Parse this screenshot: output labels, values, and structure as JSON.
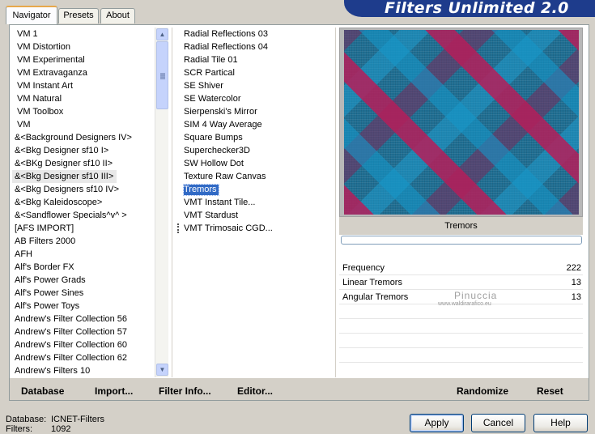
{
  "tabs": [
    {
      "label": "Navigator",
      "active": true
    },
    {
      "label": "Presets",
      "active": false
    },
    {
      "label": "About",
      "active": false
    }
  ],
  "banner": {
    "title": "Filters Unlimited 2.0"
  },
  "categories": {
    "items": [
      {
        "label": "VM 1"
      },
      {
        "label": "VM Distortion"
      },
      {
        "label": "VM Experimental"
      },
      {
        "label": "VM Extravaganza"
      },
      {
        "label": "VM Instant Art"
      },
      {
        "label": "VM Natural"
      },
      {
        "label": "VM Toolbox"
      },
      {
        "label": "VM"
      },
      {
        "label": "&<Background Designers IV>"
      },
      {
        "label": "&<Bkg Designer sf10 I>"
      },
      {
        "label": "&<BKg Designer sf10 II>"
      },
      {
        "label": "&<Bkg Designer sf10 III>",
        "selected": true
      },
      {
        "label": "&<Bkg Designers sf10 IV>"
      },
      {
        "label": "&<Bkg Kaleidoscope>"
      },
      {
        "label": "&<Sandflower Specials^v^ >"
      },
      {
        "label": "[AFS IMPORT]"
      },
      {
        "label": "AB Filters 2000"
      },
      {
        "label": "AFH"
      },
      {
        "label": "Alf's Border FX"
      },
      {
        "label": "Alf's Power Grads"
      },
      {
        "label": "Alf's Power Sines"
      },
      {
        "label": "Alf's Power Toys"
      },
      {
        "label": "Andrew's Filter Collection 56"
      },
      {
        "label": "Andrew's Filter Collection 57"
      },
      {
        "label": "Andrew's Filter Collection 60"
      },
      {
        "label": "Andrew's Filter Collection 62"
      },
      {
        "label": "Andrew's Filters 10"
      }
    ],
    "scroll_up_icon": "scroll-up-arrow-icon",
    "scroll_down_icon": "scroll-down-arrow-icon"
  },
  "filters": {
    "items": [
      {
        "label": "Radial Reflections 03"
      },
      {
        "label": "Radial Reflections 04"
      },
      {
        "label": "Radial Tile 01"
      },
      {
        "label": "SCR  Partical"
      },
      {
        "label": "SE Shiver"
      },
      {
        "label": "SE Watercolor"
      },
      {
        "label": "Sierpenski's Mirror"
      },
      {
        "label": "SIM 4 Way Average"
      },
      {
        "label": "Square Bumps"
      },
      {
        "label": "Superchecker3D"
      },
      {
        "label": "SW Hollow Dot"
      },
      {
        "label": "Texture Raw Canvas"
      },
      {
        "label": "Tremors",
        "selected": true
      },
      {
        "label": "VMT Instant Tile..."
      },
      {
        "label": "VMT Stardust"
      },
      {
        "label": "VMT Trimosaic CGD...",
        "marker": true
      }
    ]
  },
  "preview": {
    "filter_name": "Tremors",
    "progress": 0
  },
  "parameters": [
    {
      "name": "Frequency",
      "value": "222"
    },
    {
      "name": "Linear Tremors",
      "value": "13"
    },
    {
      "name": "Angular Tremors",
      "value": "13"
    },
    {
      "name": "",
      "value": ""
    },
    {
      "name": "",
      "value": ""
    },
    {
      "name": "",
      "value": ""
    },
    {
      "name": "",
      "value": ""
    },
    {
      "name": "",
      "value": ""
    }
  ],
  "watermark": {
    "line1": "Pinuccia",
    "line2": "www.waldirarafico.eu"
  },
  "bottom_links": {
    "database": "Database",
    "import": "Import...",
    "filter_info": "Filter Info...",
    "editor": "Editor...",
    "randomize": "Randomize",
    "reset": "Reset"
  },
  "status": {
    "database_label": "Database:",
    "database_value": "ICNET-Filters",
    "filters_label": "Filters:",
    "filters_value": "1092"
  },
  "buttons": {
    "apply": "Apply",
    "cancel": "Cancel",
    "help": "Help"
  }
}
